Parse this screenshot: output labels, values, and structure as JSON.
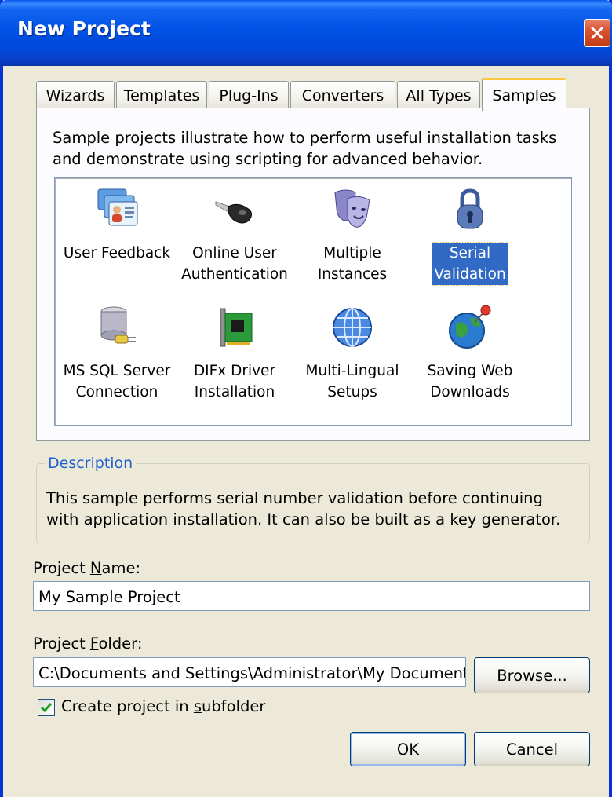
{
  "window": {
    "title": "New Project"
  },
  "tabs": [
    {
      "label": "Wizards",
      "active": false
    },
    {
      "label": "Templates",
      "active": false
    },
    {
      "label": "Plug-Ins",
      "active": false
    },
    {
      "label": "Converters",
      "active": false
    },
    {
      "label": "All Types",
      "active": false
    },
    {
      "label": "Samples",
      "active": true
    }
  ],
  "samples": {
    "intro": "Sample projects illustrate how to perform useful installation tasks and demonstrate using scripting for advanced behavior.",
    "items": [
      {
        "label": "User Feedback",
        "icon": "user-cards-icon",
        "selected": false
      },
      {
        "label": "Online User\nAuthentication",
        "icon": "key-icon",
        "selected": false
      },
      {
        "label": "Multiple\nInstances",
        "icon": "theater-masks-icon",
        "selected": false
      },
      {
        "label": "Serial\nValidation",
        "icon": "padlock-icon",
        "selected": true
      },
      {
        "label": "MS SQL Server\nConnection",
        "icon": "database-plug-icon",
        "selected": false
      },
      {
        "label": "DIFx Driver\nInstallation",
        "icon": "circuit-card-icon",
        "selected": false
      },
      {
        "label": "Multi-Lingual\nSetups",
        "icon": "globe-icon",
        "selected": false
      },
      {
        "label": "Saving Web\nDownloads",
        "icon": "globe-pin-icon",
        "selected": false
      }
    ]
  },
  "description": {
    "legend": "Description",
    "text": "This sample performs serial number validation before continuing with application installation. It can also be built as a key generator."
  },
  "project_name": {
    "label_prefix": "Project ",
    "label_mnemonic": "N",
    "label_suffix": "ame:",
    "value": "My Sample Project"
  },
  "project_folder": {
    "label_prefix": "Project ",
    "label_mnemonic": "F",
    "label_suffix": "older:",
    "value": "C:\\Documents and Settings\\Administrator\\My Documents\\InstallShield"
  },
  "browse_button": {
    "mnemonic": "B",
    "rest": "rowse..."
  },
  "subfolder_checkbox": {
    "checked": true,
    "label_prefix": "Create project in ",
    "label_mnemonic": "s",
    "label_suffix": "ubfolder"
  },
  "ok_button": {
    "label": "OK"
  },
  "cancel_button": {
    "label": "Cancel"
  },
  "colors": {
    "titlebar": "#0054e3",
    "selection": "#316ac5",
    "tab_highlight": "#ffc83c",
    "dialog_bg": "#ece9d8"
  }
}
